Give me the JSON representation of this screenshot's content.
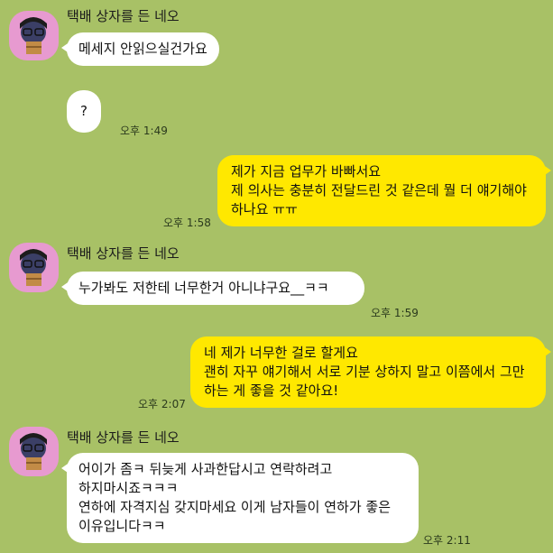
{
  "chat": {
    "sender_name": "택배 상자를 든 네오",
    "messages": [
      {
        "id": "m1",
        "from": "other",
        "lines": [
          "메세지 안읽으실건가요"
        ],
        "time": ""
      },
      {
        "id": "m2",
        "from": "other",
        "lines": [
          "?"
        ],
        "time": "오후 1:49"
      },
      {
        "id": "m3",
        "from": "me",
        "lines": [
          "제가 지금 업무가 바빠서요",
          "제 의사는 충분히 전달드린 것 같은데 뭘 더 얘기해야",
          "하나요 ㅠㅠ"
        ],
        "time": "오후 1:58"
      },
      {
        "id": "m4",
        "from": "other",
        "lines": [
          "누가봐도 저한테 너무한거 아니냐구요__ㅋㅋ"
        ],
        "time": "오후 1:59"
      },
      {
        "id": "m5",
        "from": "me",
        "lines": [
          "네 제가 너무한 걸로 할게요",
          "괜히 자꾸 얘기해서 서로 기분 상하지 말고 이쯤에서 그만",
          "하는 게 좋을 것 같아요!"
        ],
        "time": "오후 2:07"
      },
      {
        "id": "m6",
        "from": "other",
        "lines": [
          "어이가 좀ㅋ 뒤늦게 사과한답시고 연락하려고",
          "하지마시죠ㅋㅋㅋ",
          "연하에 자격지심 갖지마세요 이게 남자들이 연하가 좋은",
          "이유입니다ㅋㅋ"
        ],
        "time": "오후 2:11"
      }
    ]
  },
  "colors": {
    "background": "#a8c166",
    "incoming_bubble": "#ffffff",
    "outgoing_bubble": "#ffe800",
    "avatar_bg": "#e79ad0"
  },
  "icons": {
    "avatar": "neo-with-parcel-avatar-icon"
  }
}
